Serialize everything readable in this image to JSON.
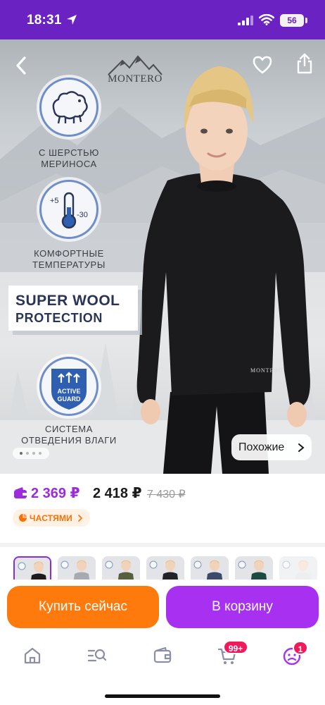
{
  "status_bar": {
    "time": "18:31",
    "battery": "56",
    "background": "#6b22c2"
  },
  "product": {
    "brand": "MONTERO",
    "features": [
      {
        "label_line1": "С ШЕРСТЬЮ",
        "label_line2": "МЕРИНОСА",
        "icon": "merino-sheep-icon"
      },
      {
        "label_line1": "КОМФОРТНЫЕ",
        "label_line2": "ТЕМПЕРАТУРЫ",
        "icon": "thermometer-icon",
        "temp_high": "+5",
        "temp_low": "-30"
      },
      {
        "label_line1": "СИСТЕМА",
        "label_line2": "ОТВЕДЕНИЯ ВЛАГИ",
        "icon": "active-guard-icon",
        "badge_line1": "ACTIVE",
        "badge_line2": "GUARD"
      }
    ],
    "banner": {
      "line1": "SUPER WOOL",
      "line2": "PROTECTION"
    },
    "shirt_print": "MONTERO",
    "similar_button": "Похожие",
    "carousel": {
      "count": 4,
      "active": 1
    }
  },
  "price": {
    "wallet_price": "2 369 ₽",
    "current_price": "2 418 ₽",
    "old_price": "7 430 ₽",
    "installments_label": "ЧАСТЯМИ",
    "wallet_color": "#9c2bdc",
    "installments_color": "#ff6e00"
  },
  "variants": [
    {
      "name": "black",
      "shirt": "#1c1c1e",
      "selected": true
    },
    {
      "name": "grey",
      "shirt": "#a7abb1",
      "selected": false
    },
    {
      "name": "olive",
      "shirt": "#56603f",
      "selected": false
    },
    {
      "name": "black-2",
      "shirt": "#232325",
      "selected": false
    },
    {
      "name": "navy",
      "shirt": "#3b4a6b",
      "selected": false
    },
    {
      "name": "green",
      "shirt": "#1e4b3f",
      "selected": false
    },
    {
      "name": "light",
      "shirt": "#d8dadd",
      "selected": false
    }
  ],
  "actions": {
    "buy_now": "Купить сейчас",
    "add_to_cart": "В корзину",
    "buy_color": "#ff7a0d",
    "cart_color": "#a830f0"
  },
  "tab_bar": {
    "items": [
      {
        "name": "home",
        "icon": "home-icon"
      },
      {
        "name": "catalog",
        "icon": "catalog-search-icon"
      },
      {
        "name": "wallet",
        "icon": "wallet-icon"
      },
      {
        "name": "cart",
        "icon": "cart-icon",
        "badge": "99+"
      },
      {
        "name": "profile",
        "icon": "profile-icon",
        "badge": "1"
      }
    ],
    "badge_color": "#f01a5a"
  }
}
